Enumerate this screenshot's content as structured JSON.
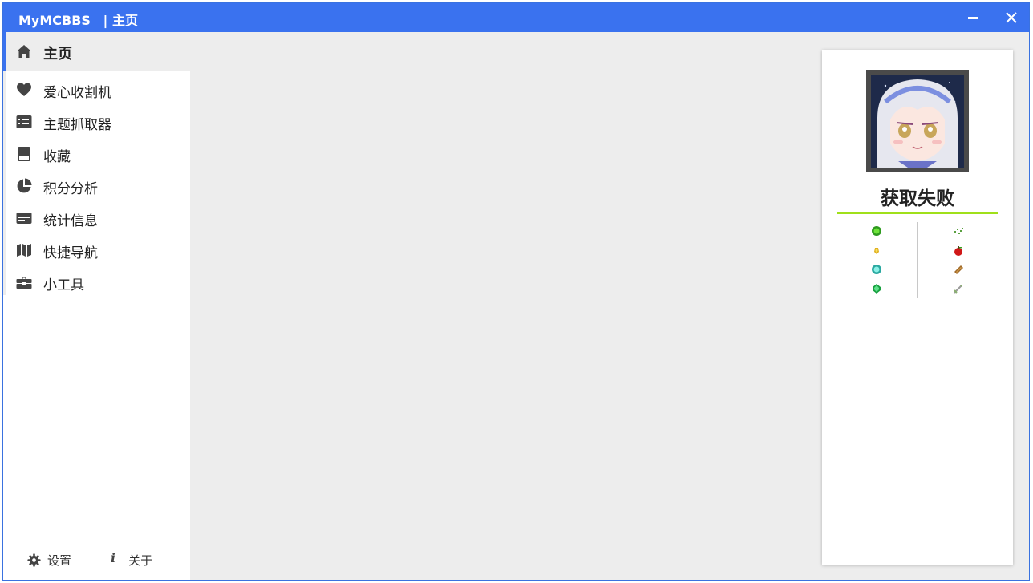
{
  "window": {
    "app_name": "MyMCBBS",
    "separator": "|",
    "page_title": "主页"
  },
  "sidebar": {
    "items": [
      {
        "label": "主页",
        "icon": "home-icon"
      },
      {
        "label": "爱心收割机",
        "icon": "heart-icon"
      },
      {
        "label": "主题抓取器",
        "icon": "list-card-icon"
      },
      {
        "label": "收藏",
        "icon": "bookmark-icon"
      },
      {
        "label": "积分分析",
        "icon": "pie-chart-icon"
      },
      {
        "label": "统计信息",
        "icon": "credit-card-icon"
      },
      {
        "label": "快捷导航",
        "icon": "map-icon"
      },
      {
        "label": "小工具",
        "icon": "toolbox-icon"
      }
    ],
    "footer": {
      "settings_label": "设置",
      "about_label": "关于",
      "about_glyph": "i"
    }
  },
  "profile": {
    "username": "获取失败",
    "accent_color": "#a0e01a",
    "stat_icons": {
      "left": [
        "green-orb-icon",
        "gold-nugget-icon",
        "diamond-icon",
        "emerald-icon"
      ],
      "right": [
        "heart-particles-icon",
        "apple-icon",
        "bread-icon",
        "arrow-item-icon"
      ]
    }
  },
  "colors": {
    "titlebar": "#3a72ef",
    "sidebar_bg": "#ffffff",
    "content_bg": "#ededed"
  }
}
